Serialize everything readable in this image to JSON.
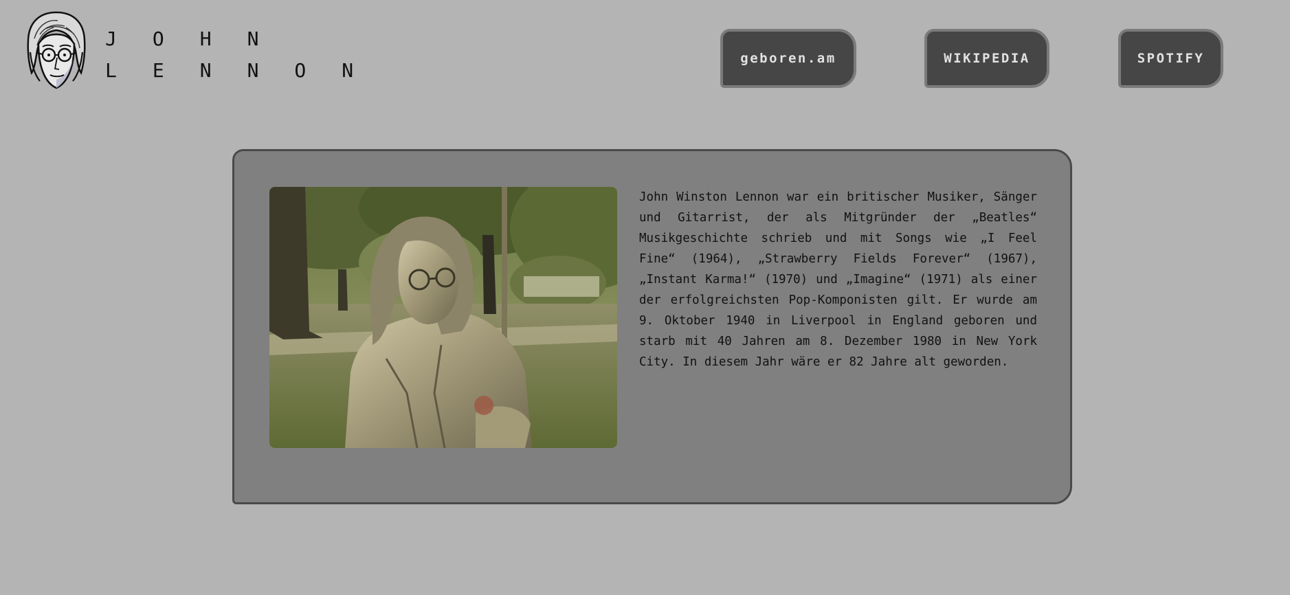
{
  "header": {
    "logo_icon": "john-lennon-portrait-icon",
    "title_line1": "JOHN",
    "title_line2": "LENNON"
  },
  "nav": {
    "born_label": "geboren.am",
    "wiki_label": "WIKIPEDIA",
    "spotify_label": "SPOTIFY"
  },
  "main": {
    "bio": "John Winston Lennon war ein britischer Musiker, Sänger und Gitarrist, der als Mitgründer der „Beatles“ Musikgeschichte schrieb und mit Songs wie „I Feel Fine“ (1964), „Strawberry Fields Forever“ (1967), „Instant Karma!“ (1970) und „Imagine“ (1971) als einer der erfolgreichsten Pop-Komponisten gilt. Er wurde am 9. Oktober 1940 in Liverpool in England geboren und starb mit 40 Jahren am 8. Dezember 1980 in New York City. In diesem Jahr wäre er 82 Jahre alt geworden."
  },
  "colors": {
    "page_background": "#b4b4b4",
    "card_background": "#808080",
    "button_background": "#464646",
    "button_text": "#e2e2e2"
  }
}
